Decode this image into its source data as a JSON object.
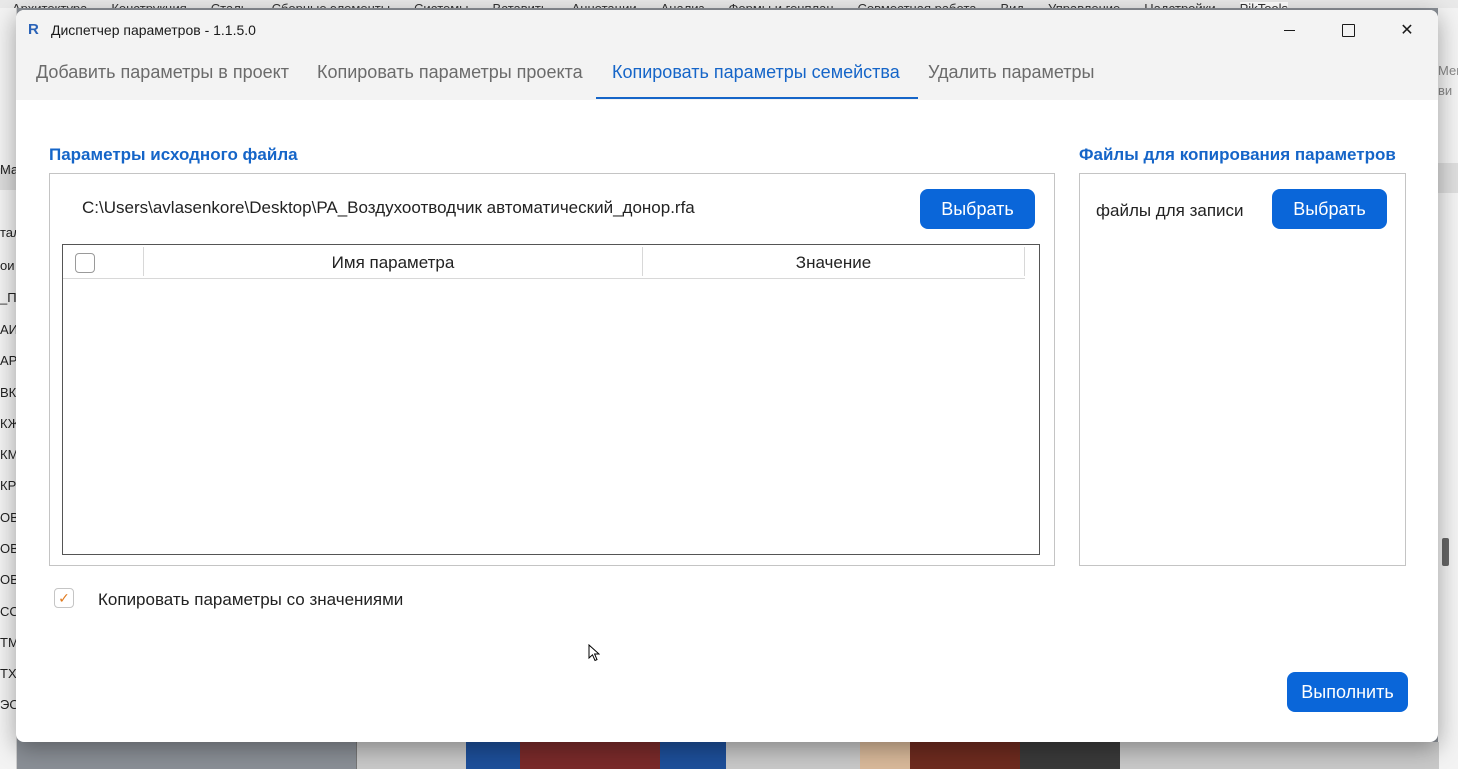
{
  "background_app": {
    "ribbon_tabs": [
      "Архитектура",
      "Конструкция",
      "Сталь",
      "Сборные элементы",
      "Системы",
      "Вставить",
      "Аннотации",
      "Анализ",
      "Формы и генплан",
      "Совместная работа",
      "Вид",
      "Управление",
      "Надстройки",
      "PikTools"
    ],
    "left_items": [
      "Ма",
      "тал",
      "ои",
      "_П",
      "АИ",
      "АР",
      "ВК",
      "КЖ",
      "КМ",
      "КР",
      "ОВ",
      "ОВ",
      "ОВ",
      "СС",
      "ТМ",
      "ТХ",
      "ЭО"
    ],
    "right_items": [
      "Мен",
      "ви"
    ]
  },
  "window": {
    "title": "Диспетчер параметров - 1.1.5.0",
    "app_icon_letter": "R",
    "close_symbol": "✕"
  },
  "tabs": [
    {
      "label": "Добавить параметры в проект"
    },
    {
      "label": "Копировать параметры проекта"
    },
    {
      "label": "Копировать параметры семейства",
      "active": true
    },
    {
      "label": "Удалить параметры"
    }
  ],
  "source": {
    "title": "Параметры исходного файла",
    "path": "C:\\Users\\avlasenkore\\Desktop\\PA_Воздухоотводчик автоматический_донор.rfa",
    "select_button": "Выбрать",
    "columns": [
      "Имя параметра",
      "Значение"
    ],
    "rows": []
  },
  "targets": {
    "title": "Файлы для копирования параметров",
    "label": "файлы для записи",
    "select_button": "Выбрать"
  },
  "copy_with_values": {
    "label": "Копировать параметры со значениями",
    "checked": true,
    "check_mark": "✓"
  },
  "run_button": "Выполнить",
  "colors": {
    "accent": "#1565c8",
    "button": "#0a66d9",
    "checkbox_mark": "#e07a1f"
  }
}
